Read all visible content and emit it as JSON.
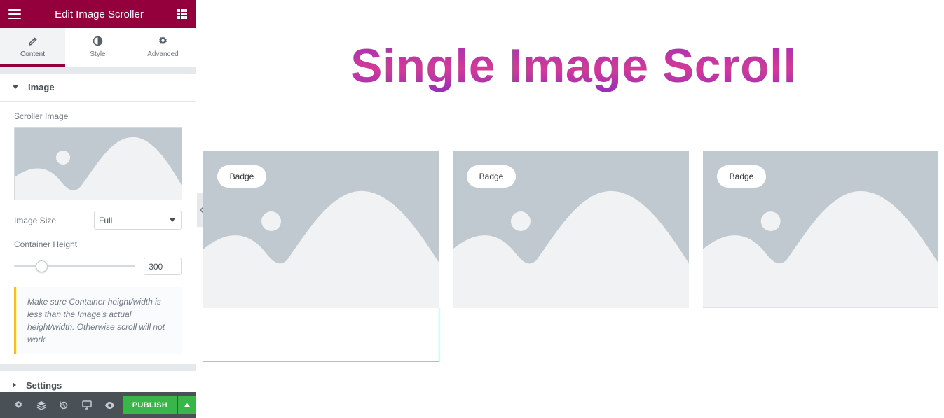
{
  "panel": {
    "title": "Edit Image Scroller",
    "tabs": [
      {
        "label": "Content",
        "icon": "pencil-icon",
        "active": true
      },
      {
        "label": "Style",
        "icon": "contrast-icon",
        "active": false
      },
      {
        "label": "Advanced",
        "icon": "gear-icon",
        "active": false
      }
    ],
    "image_section": {
      "title": "Image",
      "scroller_image_label": "Scroller Image",
      "image_size_label": "Image Size",
      "image_size_value": "Full",
      "container_height_label": "Container Height",
      "container_height_value": "300",
      "notice": "Make sure Container height/width is less than the Image's actual height/width. Otherwise scroll will not work."
    },
    "settings_section": {
      "title": "Settings"
    },
    "footer": {
      "icons": [
        "settings-icon",
        "layers-icon",
        "history-icon",
        "responsive-icon",
        "preview-eye-icon"
      ],
      "publish_label": "PUBLISH"
    },
    "accent": "#93003c"
  },
  "canvas": {
    "heading": "Single Image Scroll",
    "cards": [
      {
        "badge": "Badge"
      },
      {
        "badge": "Badge"
      },
      {
        "badge": "Badge"
      }
    ]
  }
}
